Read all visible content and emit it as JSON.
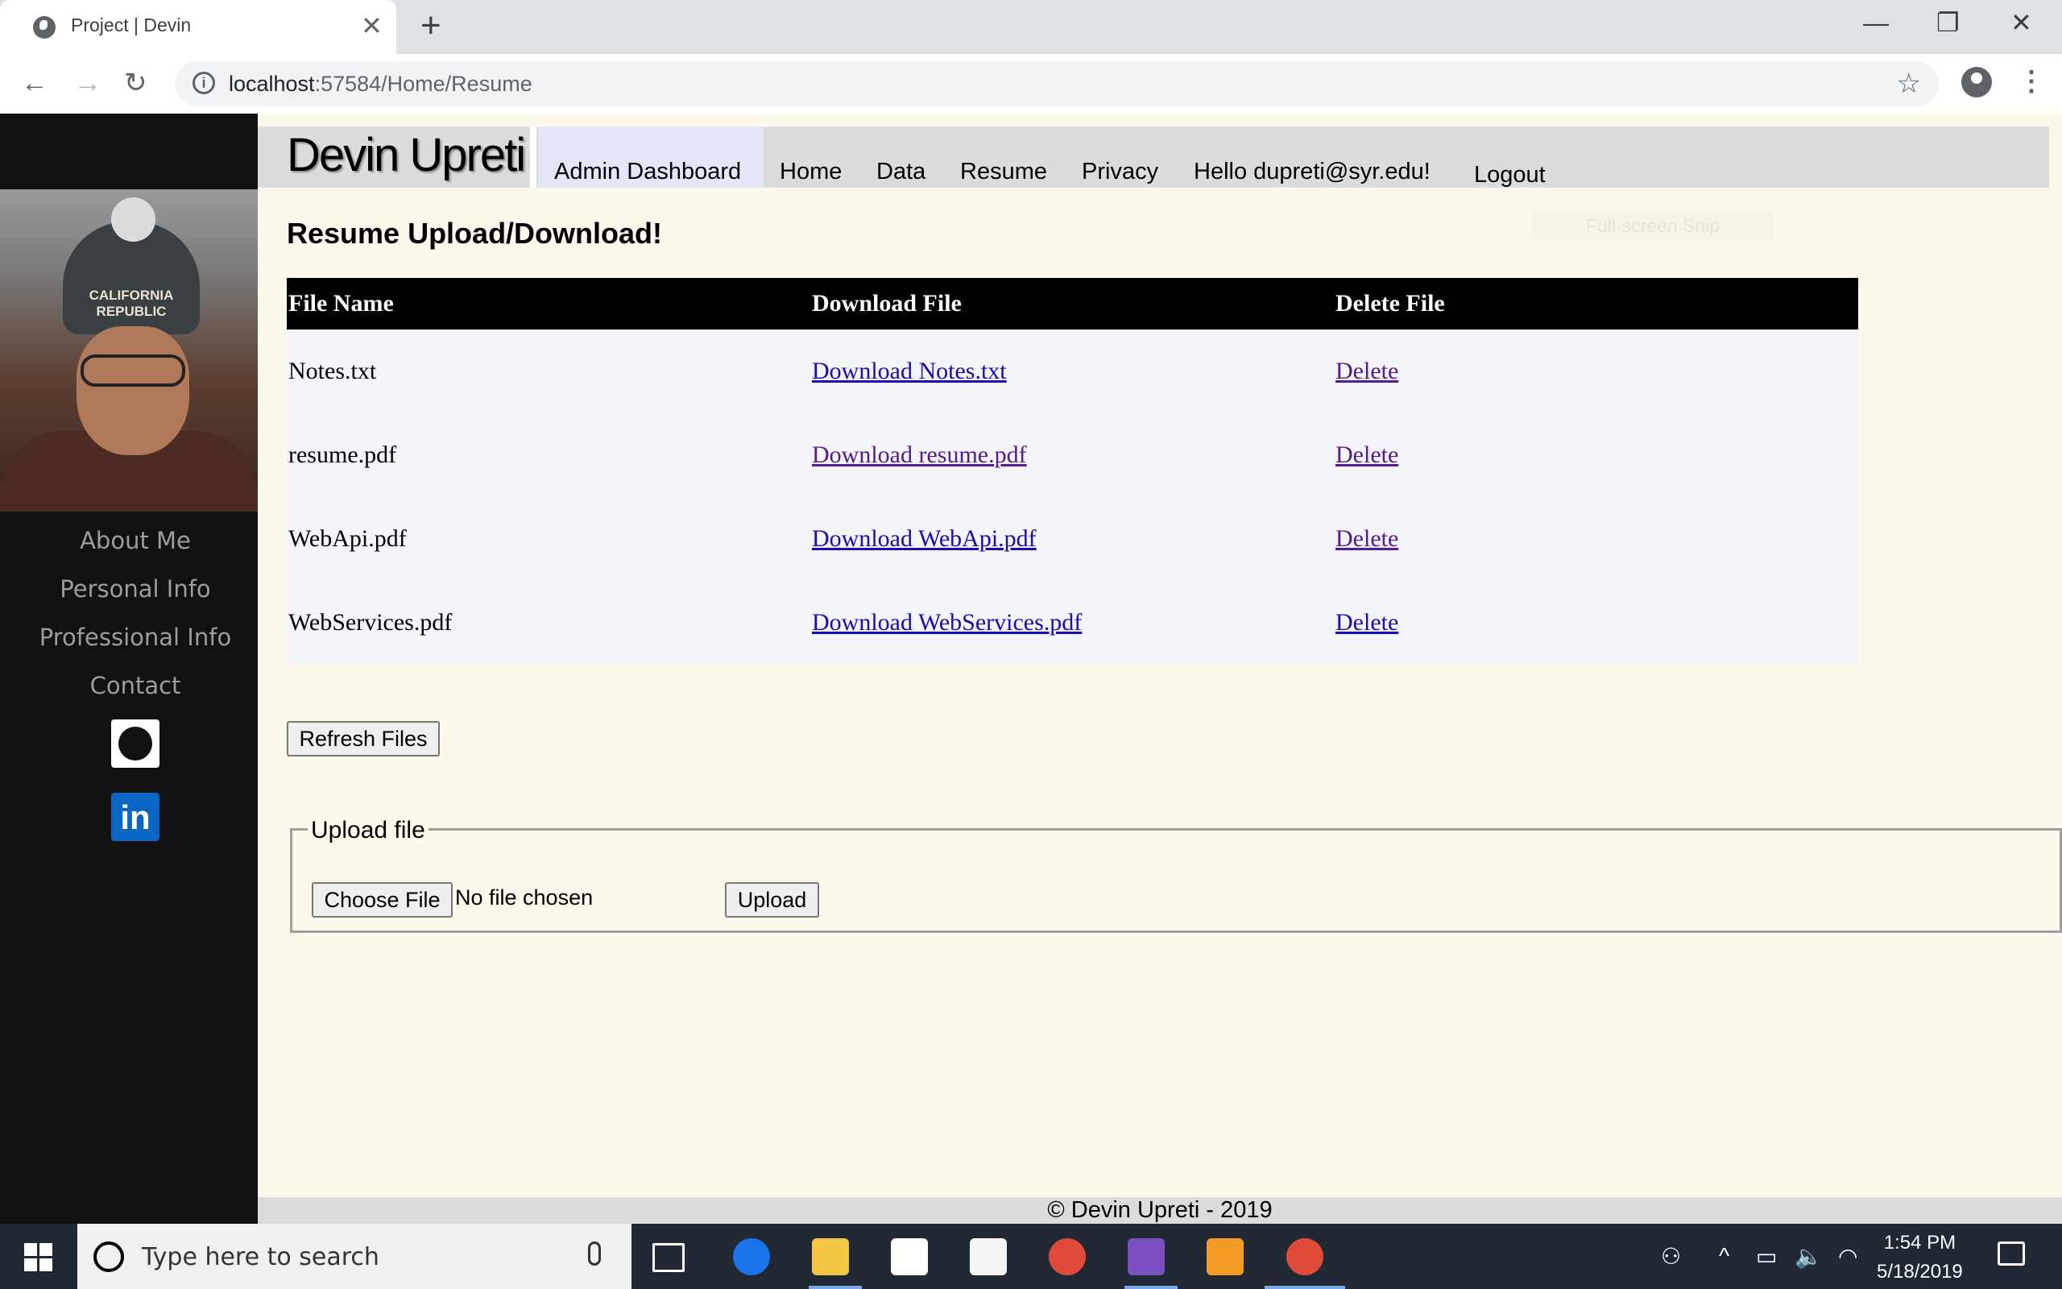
{
  "browser": {
    "tab_title": "Project | Devin",
    "url_host": "localhost",
    "url_rest": ":57584/Home/Resume"
  },
  "sidebar": {
    "links": [
      "About Me",
      "Personal Info",
      "Professional Info",
      "Contact"
    ],
    "photo_hat_text": "CALIFORNIA REPUBLIC",
    "linkedin_glyph": "in"
  },
  "header": {
    "brand": "Devin Upreti",
    "nav": [
      "Admin Dashboard",
      "Home",
      "Data",
      "Resume",
      "Privacy",
      "Hello dupreti@syr.edu!",
      "Logout"
    ]
  },
  "main": {
    "heading": "Resume Upload/Download!",
    "snip_ghost": "Full-screen Snip",
    "table": {
      "headers": [
        "File Name",
        "Download File",
        "Delete File"
      ],
      "rows": [
        {
          "name": "Notes.txt",
          "download": "Download Notes.txt",
          "delete": "Delete"
        },
        {
          "name": "resume.pdf",
          "download": "Download resume.pdf",
          "delete": "Delete"
        },
        {
          "name": "WebApi.pdf",
          "download": "Download WebApi.pdf",
          "delete": "Delete"
        },
        {
          "name": "WebServices.pdf",
          "download": "Download WebServices.pdf",
          "delete": "Delete"
        }
      ]
    },
    "refresh_label": "Refresh Files",
    "upload": {
      "legend": "Upload file",
      "choose_label": "Choose File",
      "no_file": "No file chosen",
      "upload_label": "Upload"
    }
  },
  "footer": {
    "text": "© Devin Upreti - 2019"
  },
  "taskbar": {
    "search_placeholder": "Type here to search",
    "time": "1:54 PM",
    "date": "5/18/2019"
  },
  "colors": {
    "sidebar_bg": "#111111",
    "page_bg": "#fdf8ec",
    "header_bg": "#dcdcdc",
    "admin_tab_bg": "#e6e6fa",
    "link": "#1a0dab",
    "visited_link": "#551a8b"
  }
}
